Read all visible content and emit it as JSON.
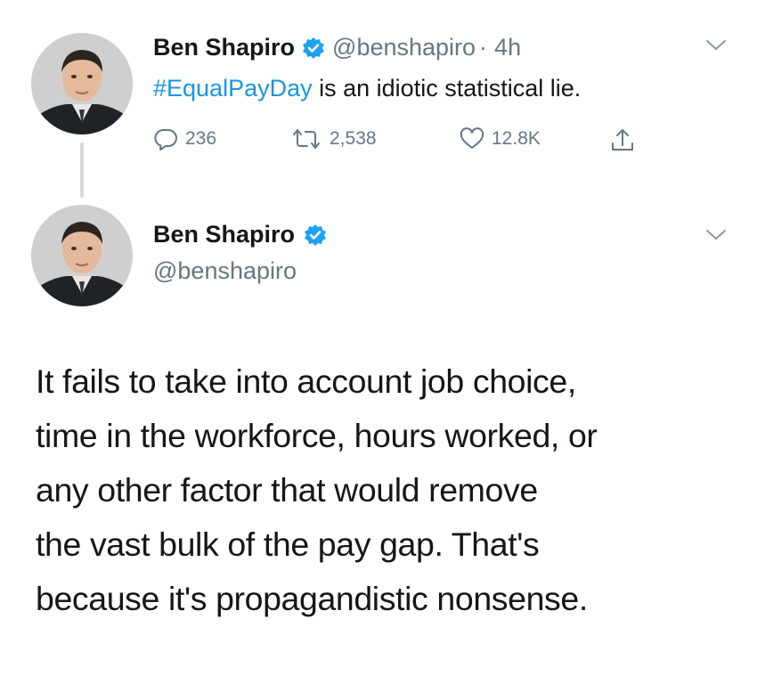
{
  "first_tweet": {
    "author_name": "Ben Shapiro",
    "handle": "@benshapiro",
    "time_sep": "·",
    "time": "4h",
    "hashtag": "#EqualPayDay",
    "text": " is an idiotic statistical lie.",
    "replies": "236",
    "retweets": "2,538",
    "likes": "12.8K",
    "avatar_icon": "person-avatar",
    "menu_icon": "chevron-down-icon"
  },
  "second_tweet": {
    "author_name": "Ben Shapiro",
    "handle": "@benshapiro",
    "text_lines": [
      "It fails to take into account job choice,",
      "time in the workforce, hours worked, or",
      "any other factor that would remove",
      "the vast bulk of the pay gap. That's",
      "because it's propagandistic nonsense."
    ],
    "avatar_icon": "person-avatar",
    "menu_icon": "chevron-down-icon"
  },
  "colors": {
    "text": "#14171a",
    "secondary": "#657786",
    "link": "#1b95e0",
    "verified": "#1da1f2",
    "thread_line": "#d4d9de"
  }
}
